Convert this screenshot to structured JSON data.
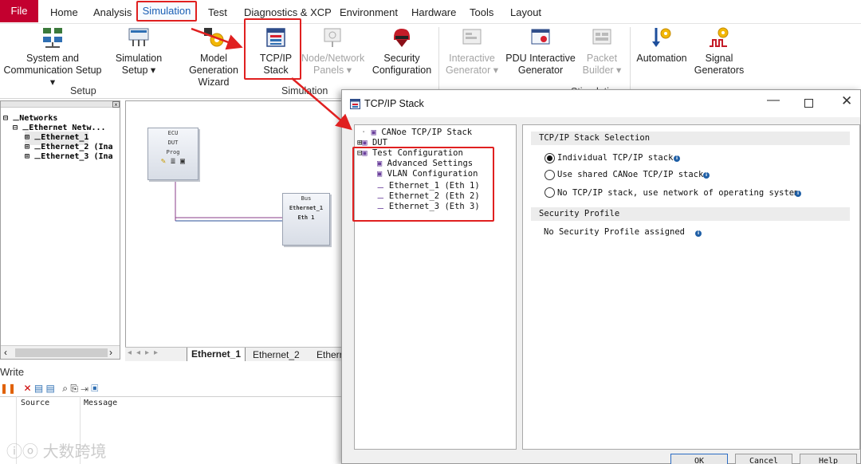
{
  "menubar": {
    "file": "File",
    "items": [
      "Home",
      "Analysis",
      "Simulation",
      "Test",
      "Diagnostics & XCP",
      "Environment",
      "Hardware",
      "Tools",
      "Layout"
    ]
  },
  "ribbon": {
    "system_comm_setup": [
      "System and",
      "Communication Setup ▾"
    ],
    "simulation_setup": [
      "Simulation",
      "Setup ▾"
    ],
    "model_gen_wizard": [
      "Model Generation",
      "Wizard"
    ],
    "tcpip_stack": [
      "TCP/IP",
      "Stack"
    ],
    "node_network_panels": [
      "Node/Network",
      "Panels ▾"
    ],
    "security_config": [
      "Security",
      "Configuration"
    ],
    "interactive_generator": [
      "Interactive",
      "Generator ▾"
    ],
    "pdu_interactive_generator": [
      "PDU Interactive",
      "Generator"
    ],
    "packet_builder": [
      "Packet",
      "Builder ▾"
    ],
    "automation": [
      "Automation"
    ],
    "signal_generators": [
      "Signal",
      "Generators"
    ],
    "group_setup": "Setup",
    "group_simulation": "Simulation",
    "group_stimulation": "Stimulation"
  },
  "left_tree": {
    "root": "Networks",
    "ethernet_network": "Ethernet Netw...",
    "items": [
      "Ethernet_1",
      "Ethernet_2 (Ina",
      "Ethernet_3 (Ina"
    ]
  },
  "canvas": {
    "ecu_node": [
      "ECU",
      "DUT",
      "Prog"
    ],
    "bus_node": [
      "Bus",
      "Ethernet_1",
      "Eth 1"
    ],
    "tabs": [
      "Ethernet_1",
      "Ethernet_2",
      "Etherr"
    ]
  },
  "write_pane": {
    "title": "Write",
    "columns": [
      "Source",
      "Message"
    ]
  },
  "dialog": {
    "title": "TCP/IP Stack",
    "tree": {
      "canoe_stack": "CANoe TCP/IP Stack",
      "dut": "DUT",
      "test_config": "Test Configuration",
      "children": [
        "Advanced Settings",
        "VLAN Configuration",
        "Ethernet_1 (Eth 1)",
        "Ethernet_2 (Eth 2)",
        "Ethernet_3 (Eth 3)"
      ]
    },
    "section_stack": "TCP/IP Stack Selection",
    "options": [
      {
        "label": "Individual TCP/IP stack",
        "selected": true
      },
      {
        "label": "Use shared CANoe TCP/IP stack",
        "selected": false
      },
      {
        "label": "No TCP/IP stack, use network of operating system",
        "selected": false
      }
    ],
    "section_security": "Security Profile",
    "security_text": "No Security Profile assigned",
    "buttons": [
      "OK",
      "Cancel",
      "Help"
    ]
  },
  "watermark": "大数跨境",
  "colors": {
    "accent_red": "#e02020",
    "file_tab": "#c3002f",
    "info_blue": "#1f5fa6",
    "selection_blue": "#1a5fb4"
  }
}
